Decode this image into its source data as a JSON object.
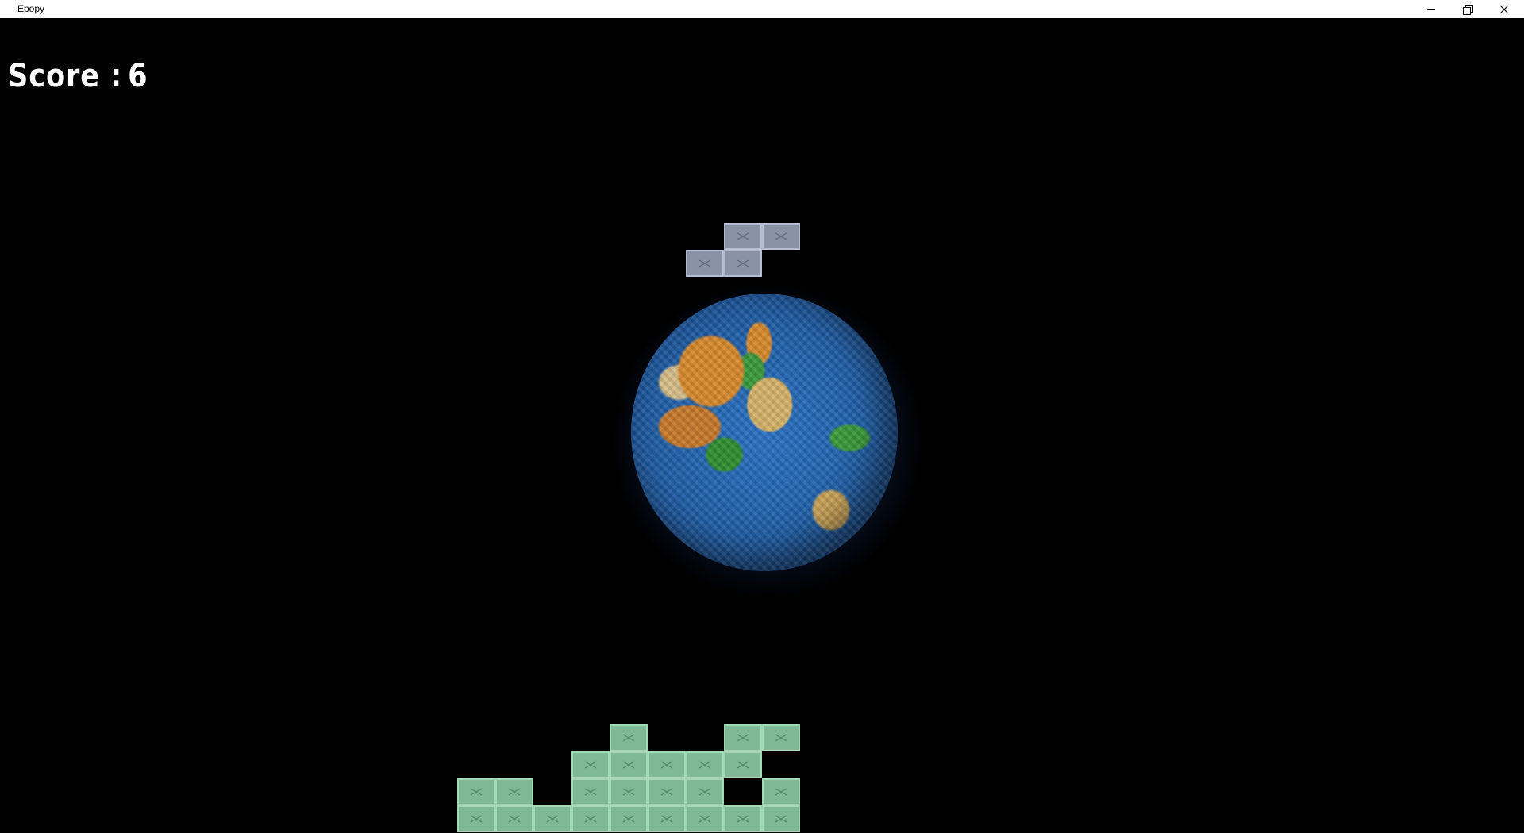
{
  "window": {
    "title": "Epopy"
  },
  "hud": {
    "score_label": "Score :",
    "score_value": "6"
  },
  "colors": {
    "background": "#000000",
    "falling_piece": "#8a92a8",
    "stacked_blocks": "#7fb995",
    "planet_ocean": "#2a74c7"
  },
  "icons": {
    "minimize": "minimize-icon",
    "maximize": "restore-icon",
    "close": "close-icon",
    "block_glyph": "x-mark-icon"
  },
  "falling_piece": {
    "shape": "S",
    "cells": [
      [
        1,
        0
      ],
      [
        2,
        0
      ],
      [
        0,
        1
      ],
      [
        1,
        1
      ]
    ]
  },
  "stacked_grid": {
    "rows": [
      [
        0,
        0,
        0,
        0,
        1,
        0,
        0,
        1,
        1
      ],
      [
        0,
        0,
        0,
        1,
        1,
        1,
        1,
        1,
        0
      ],
      [
        1,
        1,
        0,
        1,
        1,
        1,
        1,
        0,
        1
      ],
      [
        1,
        1,
        1,
        1,
        1,
        1,
        1,
        1,
        1
      ]
    ]
  }
}
